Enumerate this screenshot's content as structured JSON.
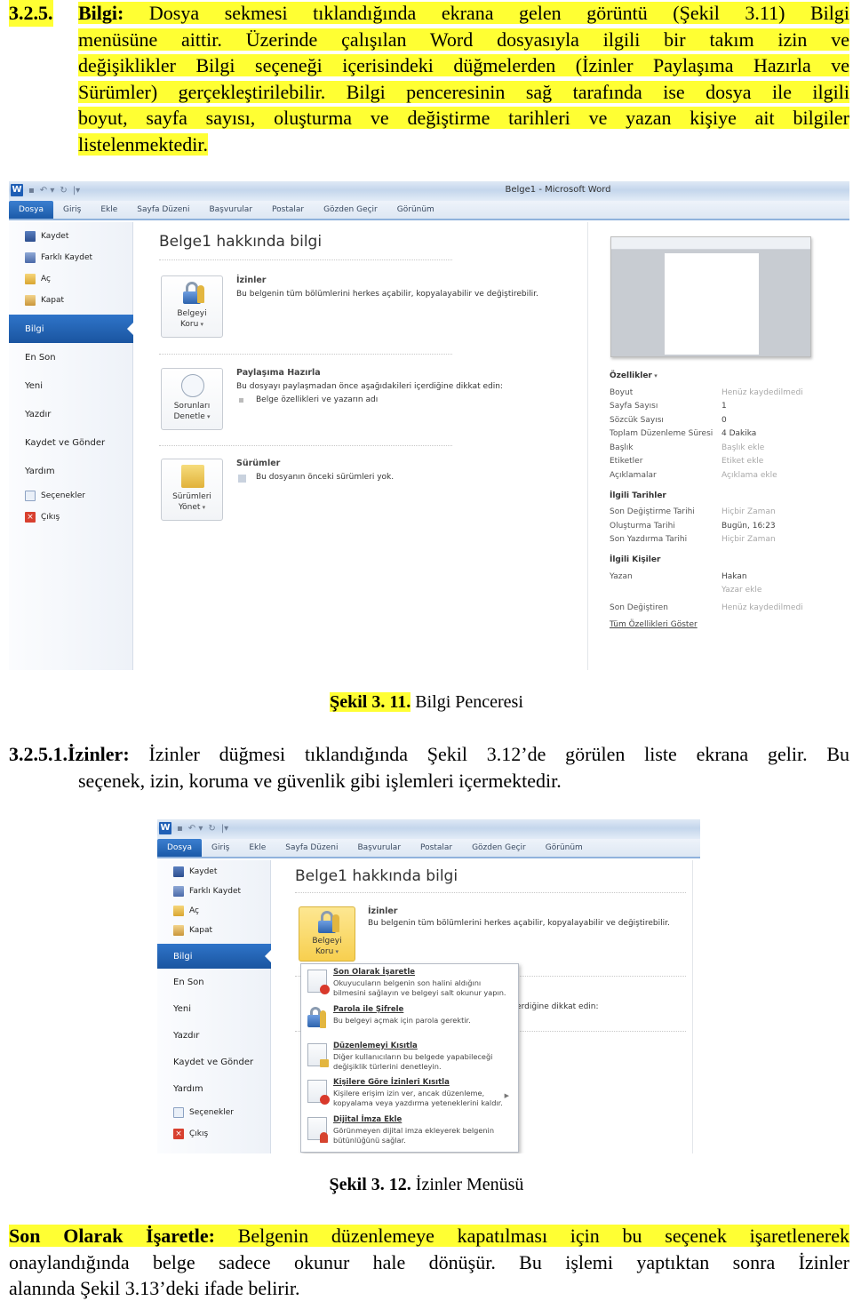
{
  "section_325": {
    "number": "3.2.5.",
    "lead": "Bilgi:",
    "lines": [
      "Dosya sekmesi tıklandığında ekrana gelen görüntü (Şekil 3.11) Bilgi",
      "menüsüne aittir.  Üzerinde çalışılan Word dosyasıyla ilgili bir takım izin ve",
      "değişiklikler Bilgi seçeneği içerisindeki düğmelerden (İzinler Paylaşıma Hazırla ve",
      "Sürümler) gerçekleştirilebilir. Bilgi penceresinin sağ tarafında ise dosya ile ilgili",
      "boyut, sayfa sayısı, oluşturma ve değiştirme tarihleri ve yazan kişiye ait bilgiler",
      "listelenmektedir."
    ]
  },
  "figure_311": {
    "window_title": "Belge1  -  Microsoft Word",
    "quick_access": [
      "word-logo",
      "save-icon",
      "undo-icon",
      "redo-icon",
      "customize-icon"
    ],
    "tabs": [
      "Dosya",
      "Giriş",
      "Ekle",
      "Sayfa Düzeni",
      "Başvurular",
      "Postalar",
      "Gözden Geçir",
      "Görünüm"
    ],
    "backstage_top": [
      "Kaydet",
      "Farklı Kaydet",
      "Aç",
      "Kapat"
    ],
    "backstage_active": "Bilgi",
    "backstage_mid": [
      "En Son",
      "Yeni",
      "Yazdır",
      "Kaydet ve Gönder",
      "Yardım"
    ],
    "backstage_bottom": [
      "Seçenekler",
      "Çıkış"
    ],
    "page_title": "Belge1 hakkında bilgi",
    "sections": [
      {
        "button": [
          "Belgeyi",
          "Koru"
        ],
        "title": "İzinler",
        "text": "Bu belgenin tüm bölümlerini herkes açabilir, kopyalayabilir ve değiştirebilir."
      },
      {
        "button": [
          "Sorunları",
          "Denetle"
        ],
        "title": "Paylaşıma Hazırla",
        "text": "Bu dosyayı paylaşmadan önce aşağıdakileri içerdiğine dikkat edin:",
        "bullet": "Belge özellikleri ve yazarın adı"
      },
      {
        "button": [
          "Sürümleri",
          "Yönet"
        ],
        "title": "Sürümler",
        "text": "Bu dosyanın önceki sürümleri yok."
      }
    ],
    "properties": {
      "header": "Özellikler",
      "rows": [
        {
          "k": "Boyut",
          "v": "Henüz kaydedilmedi",
          "placeholder": true
        },
        {
          "k": "Sayfa Sayısı",
          "v": "1",
          "placeholder": false
        },
        {
          "k": "Sözcük Sayısı",
          "v": "0",
          "placeholder": false
        },
        {
          "k": "Toplam Düzenleme Süresi",
          "v": "4 Dakika",
          "placeholder": false
        },
        {
          "k": "Başlık",
          "v": "Başlık ekle",
          "placeholder": true
        },
        {
          "k": "Etiketler",
          "v": "Etiket ekle",
          "placeholder": true
        },
        {
          "k": "Açıklamalar",
          "v": "Açıklama ekle",
          "placeholder": true
        }
      ]
    },
    "dates": {
      "header": "İlgili Tarihler",
      "rows": [
        {
          "k": "Son Değiştirme Tarihi",
          "v": "Hiçbir Zaman",
          "placeholder": true
        },
        {
          "k": "Oluşturma Tarihi",
          "v": "Bugün, 16:23",
          "placeholder": false
        },
        {
          "k": "Son Yazdırma Tarihi",
          "v": "Hiçbir Zaman",
          "placeholder": true
        }
      ]
    },
    "people": {
      "header": "İlgili Kişiler",
      "author_label": "Yazan",
      "author": "Hakan",
      "add_author": "Yazar ekle",
      "last_modified_label": "Son Değiştiren",
      "last_modified": "Henüz kaydedilmedi",
      "show_all": "Tüm Özellikleri Göster"
    }
  },
  "caption_311": {
    "bold": "Şekil 3. 11.",
    "text": "Bilgi Penceresi"
  },
  "section_3251": {
    "lead": "3.2.5.1.İzinler:",
    "line1": "İzinler düğmesi tıklandığında Şekil 3.12’de görülen liste ekrana gelir. Bu",
    "line2": "seçenek, izin, koruma ve güvenlik gibi işlemleri içermektedir."
  },
  "figure_312": {
    "tabs": [
      "Dosya",
      "Giriş",
      "Ekle",
      "Sayfa Düzeni",
      "Başvurular",
      "Postalar",
      "Gözden Geçir",
      "Görünüm"
    ],
    "backstage_top": [
      "Kaydet",
      "Farklı Kaydet",
      "Aç",
      "Kapat"
    ],
    "backstage_active": "Bilgi",
    "backstage_mid": [
      "En Son",
      "Yeni",
      "Yazdır",
      "Kaydet ve Gönder",
      "Yardım"
    ],
    "backstage_bottom": [
      "Seçenekler",
      "Çıkış"
    ],
    "page_title": "Belge1 hakkında bilgi",
    "permissions_title": "İzinler",
    "permissions_text": "Bu belgenin tüm bölümlerini herkes açabilir, kopyalayabilir ve değiştirebilir.",
    "protect_button": [
      "Belgeyi",
      "Koru"
    ],
    "behind_text": "eri içerdiğine dikkat edin:",
    "menu": [
      {
        "title": "Son Olarak İşaretle",
        "desc": "Okuyucuların belgenin son halini aldığını bilmesini sağlayın ve belgeyi salt okunur yapın.",
        "icon": "mark-final-icon"
      },
      {
        "title": "Parola ile Şifrele",
        "desc": "Bu belgeyi açmak için parola gerektir.",
        "icon": "encrypt-lock-icon"
      },
      {
        "title": "Düzenlemeyi Kısıtla",
        "desc": "Diğer kullanıcıların bu belgede yapabileceği değişiklik türlerini denetleyin.",
        "icon": "restrict-editing-icon"
      },
      {
        "title": "Kişilere Göre İzinleri Kısıtla",
        "desc": "Kişilere erişim izin ver, ancak düzenleme, kopyalama veya yazdırma yeteneklerini kaldır.",
        "icon": "restrict-permission-icon",
        "submenu": true
      },
      {
        "title": "Dijital İmza Ekle",
        "desc": "Görünmeyen dijital imza ekleyerek belgenin bütünlüğünü sağlar.",
        "icon": "digital-signature-icon"
      }
    ]
  },
  "caption_312": {
    "bold": "Şekil 3. 12.",
    "text": "İzinler Menüsü"
  },
  "paragraph_final": {
    "lead": "Son Olarak İşaretle:",
    "line1": "Belgenin düzenlemeye kapatılması için bu seçenek işaretlenerek",
    "line2": "onaylandığında belge sadece okunur hale dönüşür. Bu işlemi yaptıktan sonra İzinler",
    "line3": "alanında Şekil 3.13’deki ifade belirir."
  },
  "colors": {
    "highlight": "#ffff33",
    "file_tab": "#1b5aa8",
    "active_nav": "#2f74c9",
    "hot_button": "#f7cf4f"
  }
}
